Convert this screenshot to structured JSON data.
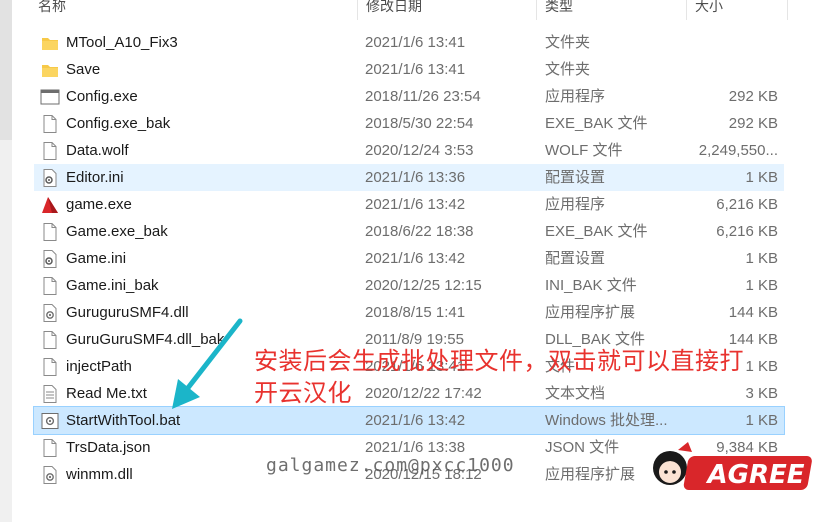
{
  "columns": {
    "name": "名称",
    "date": "修改日期",
    "type": "类型",
    "size": "大小"
  },
  "files": [
    {
      "name": "MTool_A10_Fix3",
      "date": "2021/1/6 13:41",
      "type": "文件夹",
      "size": "",
      "icon": "folder-icon",
      "state": ""
    },
    {
      "name": "Save",
      "date": "2021/1/6 13:41",
      "type": "文件夹",
      "size": "",
      "icon": "folder-icon",
      "state": ""
    },
    {
      "name": "Config.exe",
      "date": "2018/11/26 23:54",
      "type": "应用程序",
      "size": "292 KB",
      "icon": "window-app-icon",
      "state": ""
    },
    {
      "name": "Config.exe_bak",
      "date": "2018/5/30 22:54",
      "type": "EXE_BAK 文件",
      "size": "292 KB",
      "icon": "blank-file-icon",
      "state": ""
    },
    {
      "name": "Data.wolf",
      "date": "2020/12/24 3:53",
      "type": "WOLF 文件",
      "size": "2,249,550...",
      "icon": "blank-file-icon",
      "state": ""
    },
    {
      "name": "Editor.ini",
      "date": "2021/1/6 13:36",
      "type": "配置设置",
      "size": "1 KB",
      "icon": "settings-file-icon",
      "state": "hover"
    },
    {
      "name": "game.exe",
      "date": "2021/1/6 13:42",
      "type": "应用程序",
      "size": "6,216 KB",
      "icon": "game-app-icon",
      "state": ""
    },
    {
      "name": "Game.exe_bak",
      "date": "2018/6/22 18:38",
      "type": "EXE_BAK 文件",
      "size": "6,216 KB",
      "icon": "blank-file-icon",
      "state": ""
    },
    {
      "name": "Game.ini",
      "date": "2021/1/6 13:42",
      "type": "配置设置",
      "size": "1 KB",
      "icon": "settings-file-icon",
      "state": ""
    },
    {
      "name": "Game.ini_bak",
      "date": "2020/12/25 12:15",
      "type": "INI_BAK 文件",
      "size": "1 KB",
      "icon": "blank-file-icon",
      "state": ""
    },
    {
      "name": "GuruguruSMF4.dll",
      "date": "2018/8/15 1:41",
      "type": "应用程序扩展",
      "size": "144 KB",
      "icon": "dll-file-icon",
      "state": ""
    },
    {
      "name": "GuruGuruSMF4.dll_bak",
      "date": "2011/8/9 19:55",
      "type": "DLL_BAK 文件",
      "size": "144 KB",
      "icon": "blank-file-icon",
      "state": ""
    },
    {
      "name": "injectPath",
      "date": "2021/1/6 13:41",
      "type": "文件",
      "size": "1 KB",
      "icon": "blank-file-icon",
      "state": ""
    },
    {
      "name": "Read Me.txt",
      "date": "2020/12/22 17:42",
      "type": "文本文档",
      "size": "3 KB",
      "icon": "text-file-icon",
      "state": ""
    },
    {
      "name": "StartWithTool.bat",
      "date": "2021/1/6 13:42",
      "type": "Windows 批处理...",
      "size": "1 KB",
      "icon": "batch-file-icon",
      "state": "selected"
    },
    {
      "name": "TrsData.json",
      "date": "2021/1/6 13:38",
      "type": "JSON 文件",
      "size": "9,384 KB",
      "icon": "blank-file-icon",
      "state": ""
    },
    {
      "name": "winmm.dll",
      "date": "2020/12/15 18:12",
      "type": "应用程序扩展",
      "size": "",
      "icon": "dll-file-icon",
      "state": ""
    }
  ],
  "annotation": {
    "line1": "安装后会生成批处理文件，双击就可以直接打",
    "line2": "开云汉化"
  },
  "watermark": {
    "text": "galgamez.com@pxcc1000",
    "logo_text": "AGREE"
  },
  "colors": {
    "annotation_red": "#e8322e",
    "arrow_teal": "#1bb5c9",
    "selected_bg": "#cce8ff",
    "hover_bg": "#e5f3ff",
    "folder_yellow": "#f7c948"
  }
}
